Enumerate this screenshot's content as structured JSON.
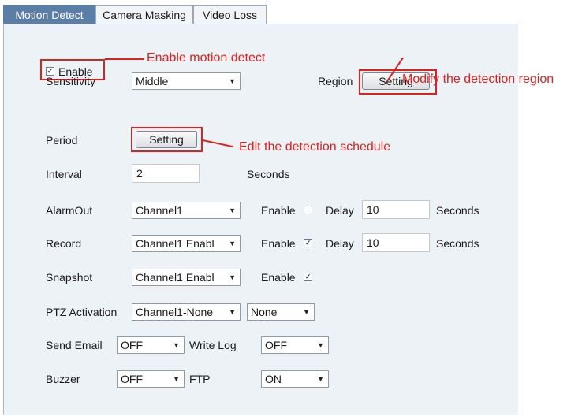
{
  "tabs": [
    {
      "label": "Motion Detect",
      "active": true
    },
    {
      "label": "Camera Masking",
      "active": false
    },
    {
      "label": "Video Loss",
      "active": false
    }
  ],
  "enable": {
    "label": "Enable",
    "checked": true,
    "check_glyph": "✓"
  },
  "sensitivity": {
    "label": "Sensitivity",
    "value": "Middle"
  },
  "region": {
    "label": "Region",
    "button": "Setting"
  },
  "period": {
    "label": "Period",
    "button": "Setting"
  },
  "interval": {
    "label": "Interval",
    "value": "2",
    "unit": "Seconds"
  },
  "alarmout": {
    "label": "AlarmOut",
    "channel": "Channel1",
    "enable_label": "Enable",
    "enabled": false,
    "delay_label": "Delay",
    "delay": "10",
    "unit": "Seconds"
  },
  "record": {
    "label": "Record",
    "channel": "Channel1 Enabl",
    "enable_label": "Enable",
    "enabled": true,
    "delay_label": "Delay",
    "delay": "10",
    "unit": "Seconds"
  },
  "snapshot": {
    "label": "Snapshot",
    "channel": "Channel1 Enabl",
    "enable_label": "Enable",
    "enabled": true
  },
  "ptz": {
    "label": "PTZ Activation",
    "channel": "Channel1-None",
    "mode": "None"
  },
  "send_email": {
    "label": "Send Email",
    "value": "OFF"
  },
  "write_log": {
    "label": "Write Log",
    "value": "OFF"
  },
  "buzzer": {
    "label": "Buzzer",
    "value": "OFF"
  },
  "ftp": {
    "label": "FTP",
    "value": "ON"
  },
  "annotations": {
    "enable_note": "Enable motion detect",
    "region_note": "Modify the detection region",
    "schedule_note": "Edit the detection schedule",
    "color": "#e0201c"
  },
  "icons": {
    "dropdown": "▼",
    "check": "✓"
  }
}
